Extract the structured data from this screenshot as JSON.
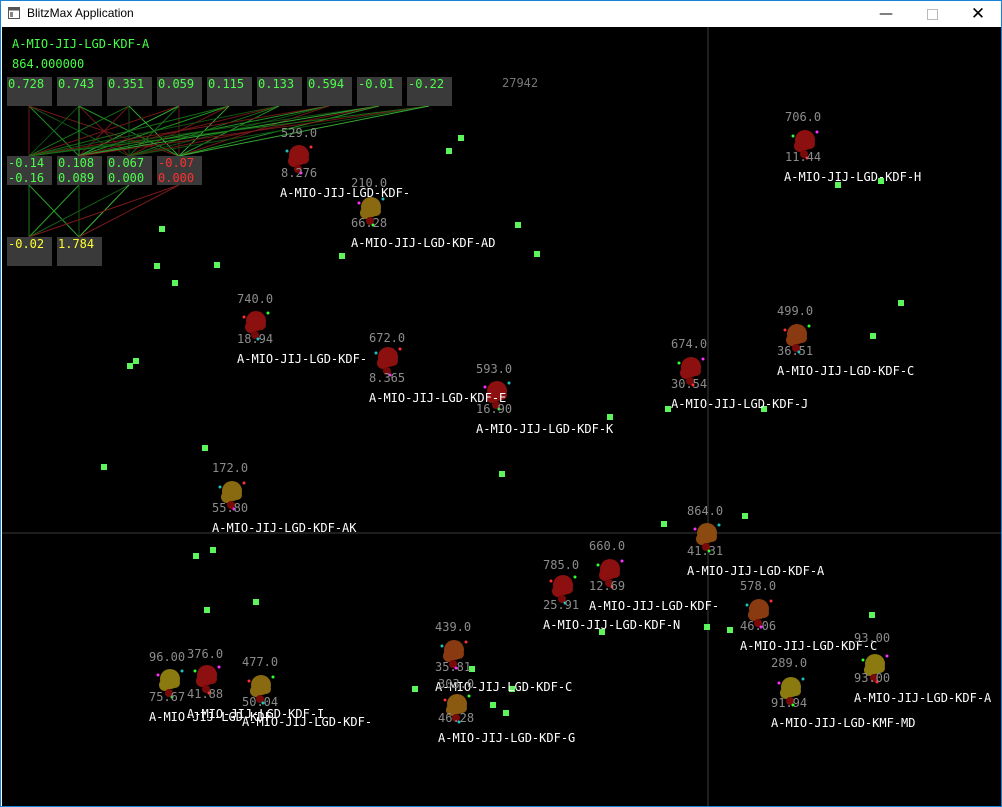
{
  "window": {
    "title": "BlitzMax Application",
    "controls": {
      "minimize": "—",
      "maximize": "",
      "close": "✕"
    }
  },
  "hud": {
    "selected_name": "A-MIO-JIJ-LGD-KDF-A",
    "selected_value": "864.000000",
    "score": "27942"
  },
  "network": {
    "inputs": [
      {
        "v": "0.728",
        "c": "g"
      },
      {
        "v": "0.743",
        "c": "g"
      },
      {
        "v": "0.351",
        "c": "g"
      },
      {
        "v": "0.059",
        "c": "g"
      },
      {
        "v": "0.115",
        "c": "g"
      },
      {
        "v": "0.133",
        "c": "g"
      },
      {
        "v": "0.594",
        "c": "g"
      },
      {
        "v": "-0.01",
        "c": "g"
      },
      {
        "v": "-0.22",
        "c": "g"
      }
    ],
    "hidden": [
      {
        "a": "-0.14",
        "b": "-0.16",
        "c": "g"
      },
      {
        "a": "0.108",
        "b": "0.089",
        "c": "g"
      },
      {
        "a": "0.067",
        "b": "0.000",
        "c": "g"
      },
      {
        "a": "-0.07",
        "b": "0.000",
        "c": "r"
      }
    ],
    "outputs": [
      {
        "v": "-0.02",
        "c": "y"
      },
      {
        "v": "1.784",
        "c": "y"
      }
    ]
  },
  "creatures": [
    {
      "energy": "529.0",
      "fitness": "8.276",
      "name": "A-MIO-JIJ-LGD-KDF-",
      "color": "#8c1010"
    },
    {
      "energy": "210.0",
      "fitness": "66.28",
      "name": "A-MIO-JIJ-LGD-KDF-AD",
      "color": "#8a6a10"
    },
    {
      "energy": "706.0",
      "fitness": "11.44",
      "name": "A-MIO-JIJ-LGD-KDF-H",
      "color": "#8c1010"
    },
    {
      "energy": "740.0",
      "fitness": "18.94",
      "name": "A-MIO-JIJ-LGD-KDF-",
      "color": "#8c1010"
    },
    {
      "energy": "672.0",
      "fitness": "8.365",
      "name": "A-MIO-JIJ-LGD-KDF-E",
      "color": "#8c1010"
    },
    {
      "energy": "593.0",
      "fitness": "16.90",
      "name": "A-MIO-JIJ-LGD-KDF-K",
      "color": "#8c1010"
    },
    {
      "energy": "674.0",
      "fitness": "30.54",
      "name": "A-MIO-JIJ-LGD-KDF-J",
      "color": "#8c1010"
    },
    {
      "energy": "499.0",
      "fitness": "36.51",
      "name": "A-MIO-JIJ-LGD-KDF-C",
      "color": "#8a3a10"
    },
    {
      "energy": "172.0",
      "fitness": "55.80",
      "name": "A-MIO-JIJ-LGD-KDF-AK",
      "color": "#8a6a10"
    },
    {
      "energy": "864.0",
      "fitness": "41.31",
      "name": "A-MIO-JIJ-LGD-KDF-A",
      "color": "#8a4a10"
    },
    {
      "energy": "660.0",
      "fitness": "12.69",
      "name": "A-MIO-JIJ-LGD-KDF-",
      "color": "#8c1010"
    },
    {
      "energy": "785.0",
      "fitness": "25.91",
      "name": "A-MIO-JIJ-LGD-KDF-N",
      "color": "#8c1010"
    },
    {
      "energy": "578.0",
      "fitness": "46.06",
      "name": "A-MIO-JIJ-LGD-KDF-C",
      "color": "#8a3a10"
    },
    {
      "energy": "96.00",
      "fitness": "75.67",
      "name": "A-MIO-JIJ-LGD-KDF-",
      "color": "#8a7a10"
    },
    {
      "energy": "376.0",
      "fitness": "41.88",
      "name": "A-MIO-JIJ-LGD-KDF-I",
      "color": "#8c1010"
    },
    {
      "energy": "477.0",
      "fitness": "50.04",
      "name": "A-MIO-JIJ-LGD-KDF-",
      "color": "#8a6a10"
    },
    {
      "energy": "439.0",
      "fitness": "35.81",
      "name": "A-MIO-JIJ-LGD-KDF-C",
      "color": "#8a3a10"
    },
    {
      "energy": "289.0",
      "fitness": "91.94",
      "name": "A-MIO-JIJ-LGD-KMF-MD",
      "color": "#8a7a10"
    },
    {
      "energy": "93.00",
      "fitness": "93.00",
      "name": "A-MIO-JIJ-LGD-KDF-A",
      "color": "#8a7a10"
    },
    {
      "energy": "303.0",
      "fitness": "46.28",
      "name": "A-MIO-JIJ-LGD-KDF-G",
      "color": "#8a5a10"
    }
  ]
}
